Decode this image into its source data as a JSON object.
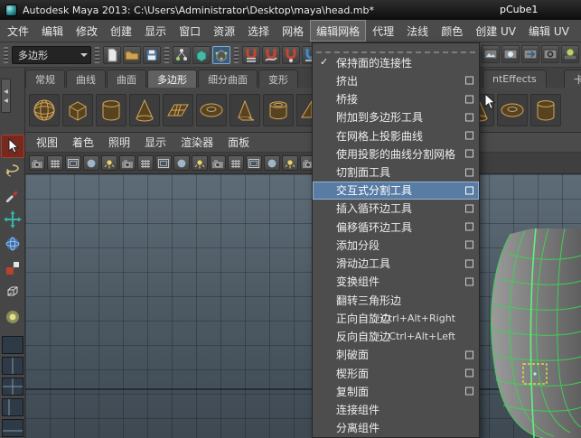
{
  "titlebar": {
    "title": "Autodesk Maya 2013: C:\\Users\\Administrator\\Desktop\\maya\\head.mb*",
    "selection": "pCube1"
  },
  "menubar": {
    "items": [
      "文件",
      "编辑",
      "修改",
      "创建",
      "显示",
      "窗口",
      "资源",
      "选择",
      "网格",
      "编辑网格",
      "代理",
      "法线",
      "颜色",
      "创建 UV",
      "编辑 UV"
    ],
    "active": "编辑网格"
  },
  "statusline": {
    "menuset": "多边形",
    "left_groups": [
      [
        "new-scene",
        "open-scene",
        "save-scene"
      ],
      [
        "select-hierarchy",
        "select-object",
        "select-component"
      ],
      [
        "snap-grid",
        "snap-curve",
        "snap-point",
        "make-live"
      ]
    ],
    "active_icon": "select-component",
    "right_icons": [
      "render-view",
      "render-current-frame",
      "ipr-render",
      "render-settings",
      "hypershade"
    ]
  },
  "shelf": {
    "tabs": [
      "常规",
      "曲线",
      "曲面",
      "多边形",
      "细分曲面",
      "变形"
    ],
    "active_tab": "多边形",
    "right_tabs": [
      "ntEffects",
      "卡通"
    ],
    "icons": [
      "poly-sphere",
      "poly-cube",
      "poly-cylinder",
      "poly-cone",
      "poly-plane",
      "poly-torus",
      "poly-prism",
      "poly-pipe",
      "poly-pyramid",
      "poly-helix",
      "poly-soccer",
      "poly-sphere",
      "poly-cube",
      "poly-cone",
      "poly-torus",
      "poly-cylinder"
    ]
  },
  "panel": {
    "menus": [
      "视图",
      "着色",
      "照明",
      "显示",
      "渲染器",
      "面板"
    ],
    "toolbar_icons": [
      "select-camera",
      "lock-camera",
      "camera-attributes",
      "bookmarks",
      "image-plane",
      "two-d-pan-zoom",
      "grease-pencil",
      "grid-toggle",
      "film-gate",
      "resolution-gate",
      "gate-mask",
      "field-chart",
      "safe-action",
      "safe-title",
      "wireframe-mode",
      "shaded-mode",
      "textured-mode",
      "use-all-lights",
      "shadows",
      "screen-space-ao",
      "motion-blur",
      "multisample",
      "depth-of-field",
      "isolate-select",
      "x-ray"
    ]
  },
  "toolbox": {
    "tools": [
      {
        "name": "select-tool",
        "active": true
      },
      {
        "name": "lasso-tool",
        "active": false
      },
      {
        "name": "paint-select-tool",
        "active": false
      },
      {
        "name": "move-tool",
        "active": false
      },
      {
        "name": "rotate-tool",
        "active": false
      },
      {
        "name": "scale-tool",
        "active": false
      },
      {
        "name": "universal-manipulator-tool",
        "active": false
      },
      {
        "name": "soft-mod-tool",
        "active": false
      }
    ],
    "layouts": [
      "single-pane",
      "two-pane-vertical",
      "four-pane",
      "persp-outliner",
      "persp-graph"
    ]
  },
  "edit_mesh_menu": {
    "items": [
      {
        "label": "保持面的连接性",
        "checked": true,
        "option_box": false,
        "highlighted": false,
        "shortcut": ""
      },
      {
        "label": "挤出",
        "checked": false,
        "option_box": true,
        "highlighted": false,
        "shortcut": ""
      },
      {
        "label": "桥接",
        "checked": false,
        "option_box": true,
        "highlighted": false,
        "shortcut": ""
      },
      {
        "label": "附加到多边形工具",
        "checked": false,
        "option_box": true,
        "highlighted": false,
        "shortcut": ""
      },
      {
        "label": "在网格上投影曲线",
        "checked": false,
        "option_box": true,
        "highlighted": false,
        "shortcut": ""
      },
      {
        "label": "使用投影的曲线分割网格",
        "checked": false,
        "option_box": true,
        "highlighted": false,
        "shortcut": ""
      },
      {
        "label": "切割面工具",
        "checked": false,
        "option_box": true,
        "highlighted": false,
        "shortcut": ""
      },
      {
        "label": "交互式分割工具",
        "checked": false,
        "option_box": true,
        "highlighted": true,
        "shortcut": ""
      },
      {
        "label": "插入循环边工具",
        "checked": false,
        "option_box": true,
        "highlighted": false,
        "shortcut": ""
      },
      {
        "label": "偏移循环边工具",
        "checked": false,
        "option_box": true,
        "highlighted": false,
        "shortcut": ""
      },
      {
        "label": "添加分段",
        "checked": false,
        "option_box": true,
        "highlighted": false,
        "shortcut": ""
      },
      {
        "label": "滑动边工具",
        "checked": false,
        "option_box": true,
        "highlighted": false,
        "shortcut": ""
      },
      {
        "label": "变换组件",
        "checked": false,
        "option_box": true,
        "highlighted": false,
        "shortcut": ""
      },
      {
        "label": "翻转三角形边",
        "checked": false,
        "option_box": false,
        "highlighted": false,
        "shortcut": ""
      },
      {
        "label": "正向自旋边",
        "checked": false,
        "option_box": false,
        "highlighted": false,
        "shortcut": "Ctrl+Alt+Right"
      },
      {
        "label": "反向自旋边",
        "checked": false,
        "option_box": false,
        "highlighted": false,
        "shortcut": "Ctrl+Alt+Left"
      },
      {
        "label": "刺破面",
        "checked": false,
        "option_box": true,
        "highlighted": false,
        "shortcut": ""
      },
      {
        "label": "楔形面",
        "checked": false,
        "option_box": true,
        "highlighted": false,
        "shortcut": ""
      },
      {
        "label": "复制面",
        "checked": false,
        "option_box": true,
        "highlighted": false,
        "shortcut": ""
      },
      {
        "label": "连接组件",
        "checked": false,
        "option_box": false,
        "highlighted": false,
        "shortcut": ""
      },
      {
        "label": "分离组件",
        "checked": false,
        "option_box": false,
        "highlighted": false,
        "shortcut": ""
      }
    ]
  },
  "glyphs": {
    "check": "✓",
    "collapse": "◀"
  },
  "colors": {
    "menu_highlight": "#587ca3",
    "active_tool": "#78281c",
    "wireframe_green": "#3ecf55",
    "selection_yellow": "#efe93f",
    "viewport_top": "#5e6c77",
    "viewport_bottom": "#3e4952",
    "shelf_icon_tan": "#d2a55f"
  }
}
